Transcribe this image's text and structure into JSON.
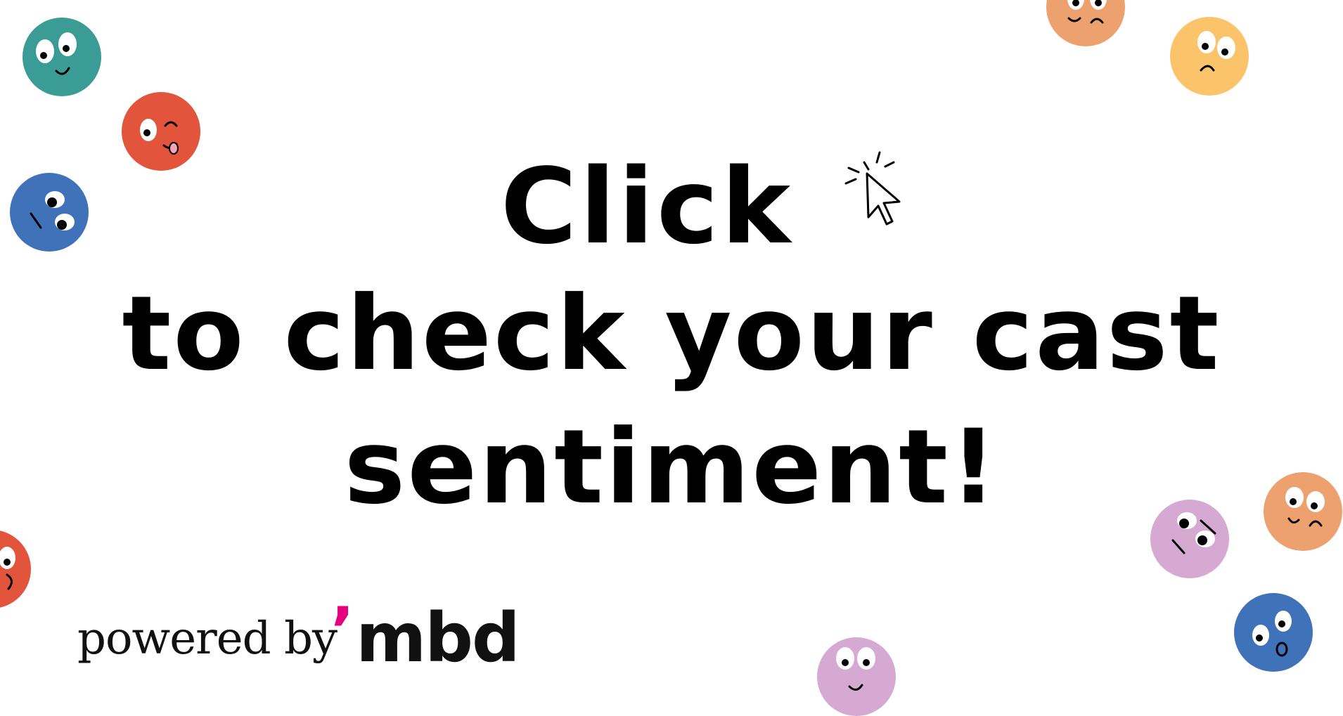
{
  "headline": {
    "line1": "Click",
    "line2": "to check your cast",
    "line3": "sentiment!"
  },
  "footer": {
    "powered_by": "powered by",
    "logo_mark": "’",
    "logo_word": "mbd"
  },
  "colors": {
    "text": "#000000",
    "teal": "#3a9c94",
    "red": "#e2543b",
    "blue": "#3f72b8",
    "orange": "#eca16e",
    "yellow": "#fbc46b",
    "lilac": "#d6a9d2",
    "logo_accent": "#e5007e"
  },
  "icons": {
    "cursor": "cursor-click-icon",
    "emojis": [
      "teal-smile-emoji-icon",
      "red-wink-tongue-emoji-icon",
      "blue-sleepy-emoji-icon",
      "orange-worried-emoji-icon",
      "yellow-sad-emoji-icon",
      "red-cutoff-emoji-icon",
      "lilac-bored-emoji-icon",
      "orange-sad-emoji-icon",
      "blue-surprised-emoji-icon",
      "lilac-smile-emoji-icon"
    ]
  }
}
